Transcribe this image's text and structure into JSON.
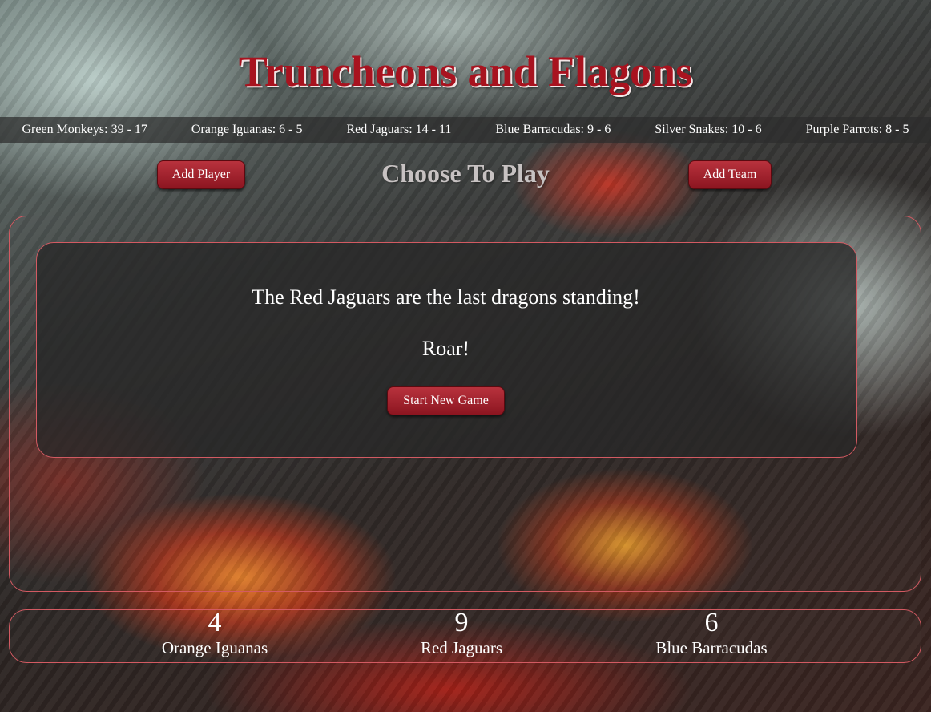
{
  "header": {
    "title": "Truncheons and Flagons"
  },
  "standings": [
    {
      "label": "Green Monkeys: 39 - 17"
    },
    {
      "label": "Orange Iguanas: 6 - 5"
    },
    {
      "label": "Red Jaguars: 14 - 11"
    },
    {
      "label": "Blue Barracudas: 9 - 6"
    },
    {
      "label": "Silver Snakes: 10 - 6"
    },
    {
      "label": "Purple Parrots: 8 - 5"
    }
  ],
  "toolbar": {
    "add_player_label": "Add Player",
    "heading": "Choose To Play",
    "add_team_label": "Add Team"
  },
  "result": {
    "message": "The Red Jaguars are the last dragons standing!",
    "roar": "Roar!",
    "start_button_label": "Start New Game"
  },
  "scores": [
    {
      "value": "4",
      "team": "Orange Iguanas"
    },
    {
      "value": "9",
      "team": "Red Jaguars"
    },
    {
      "value": "6",
      "team": "Blue Barracudas"
    }
  ],
  "colors": {
    "title": "#a8131f",
    "button": "#a3222c",
    "panel_border": "#d35a62"
  }
}
